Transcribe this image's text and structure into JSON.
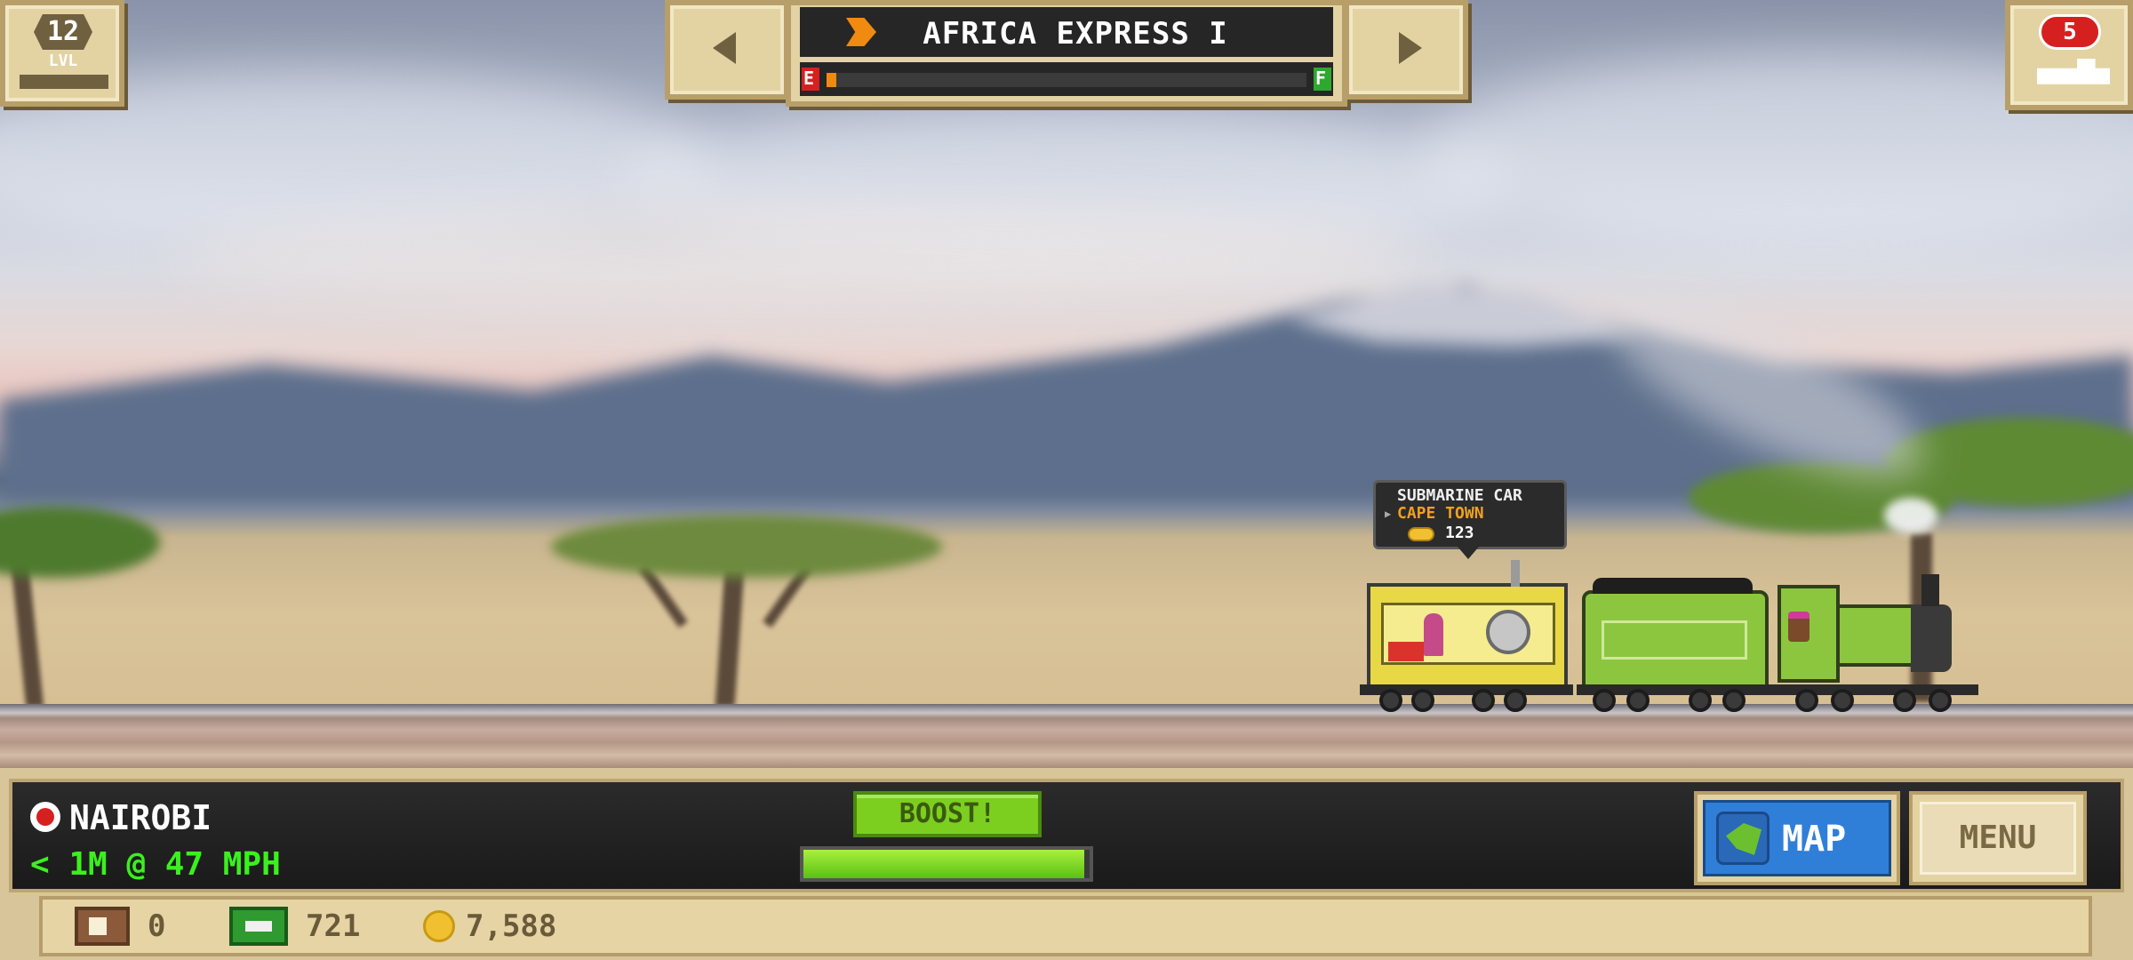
{
  "level": {
    "number": "12",
    "label": "LVL"
  },
  "train_selector": {
    "name": "AFRICA EXPRESS I",
    "fuel_empty_label": "E",
    "fuel_full_label": "F",
    "fuel_level": 0.02,
    "prev_icon": "arrow-left-icon",
    "next_icon": "arrow-right-icon"
  },
  "trains_count": {
    "number": "5",
    "icon": "locomotive-icon"
  },
  "cargo_tooltip": {
    "car_name": "SUBMARINE CAR",
    "destination": "CAPE TOWN",
    "payout": "123",
    "icon": "coin-icon"
  },
  "station": {
    "name": "NAIROBI",
    "distance_speed": "< 1M @ 47 MPH",
    "icon": "station-marker-icon"
  },
  "boost": {
    "label": "BOOST!",
    "charge": 1.0
  },
  "nav": {
    "map_label": "MAP",
    "menu_label": "MENU"
  },
  "currencies": {
    "crates": "0",
    "cash": "721",
    "coins": "7,588"
  },
  "colors": {
    "boost_green": "#7ccf1f",
    "speed_green": "#3bf01e",
    "map_blue": "#2f7fd8",
    "tooltip_orange": "#f0a020",
    "badge_red": "#d62020",
    "engine_green": "#8cc63f"
  }
}
